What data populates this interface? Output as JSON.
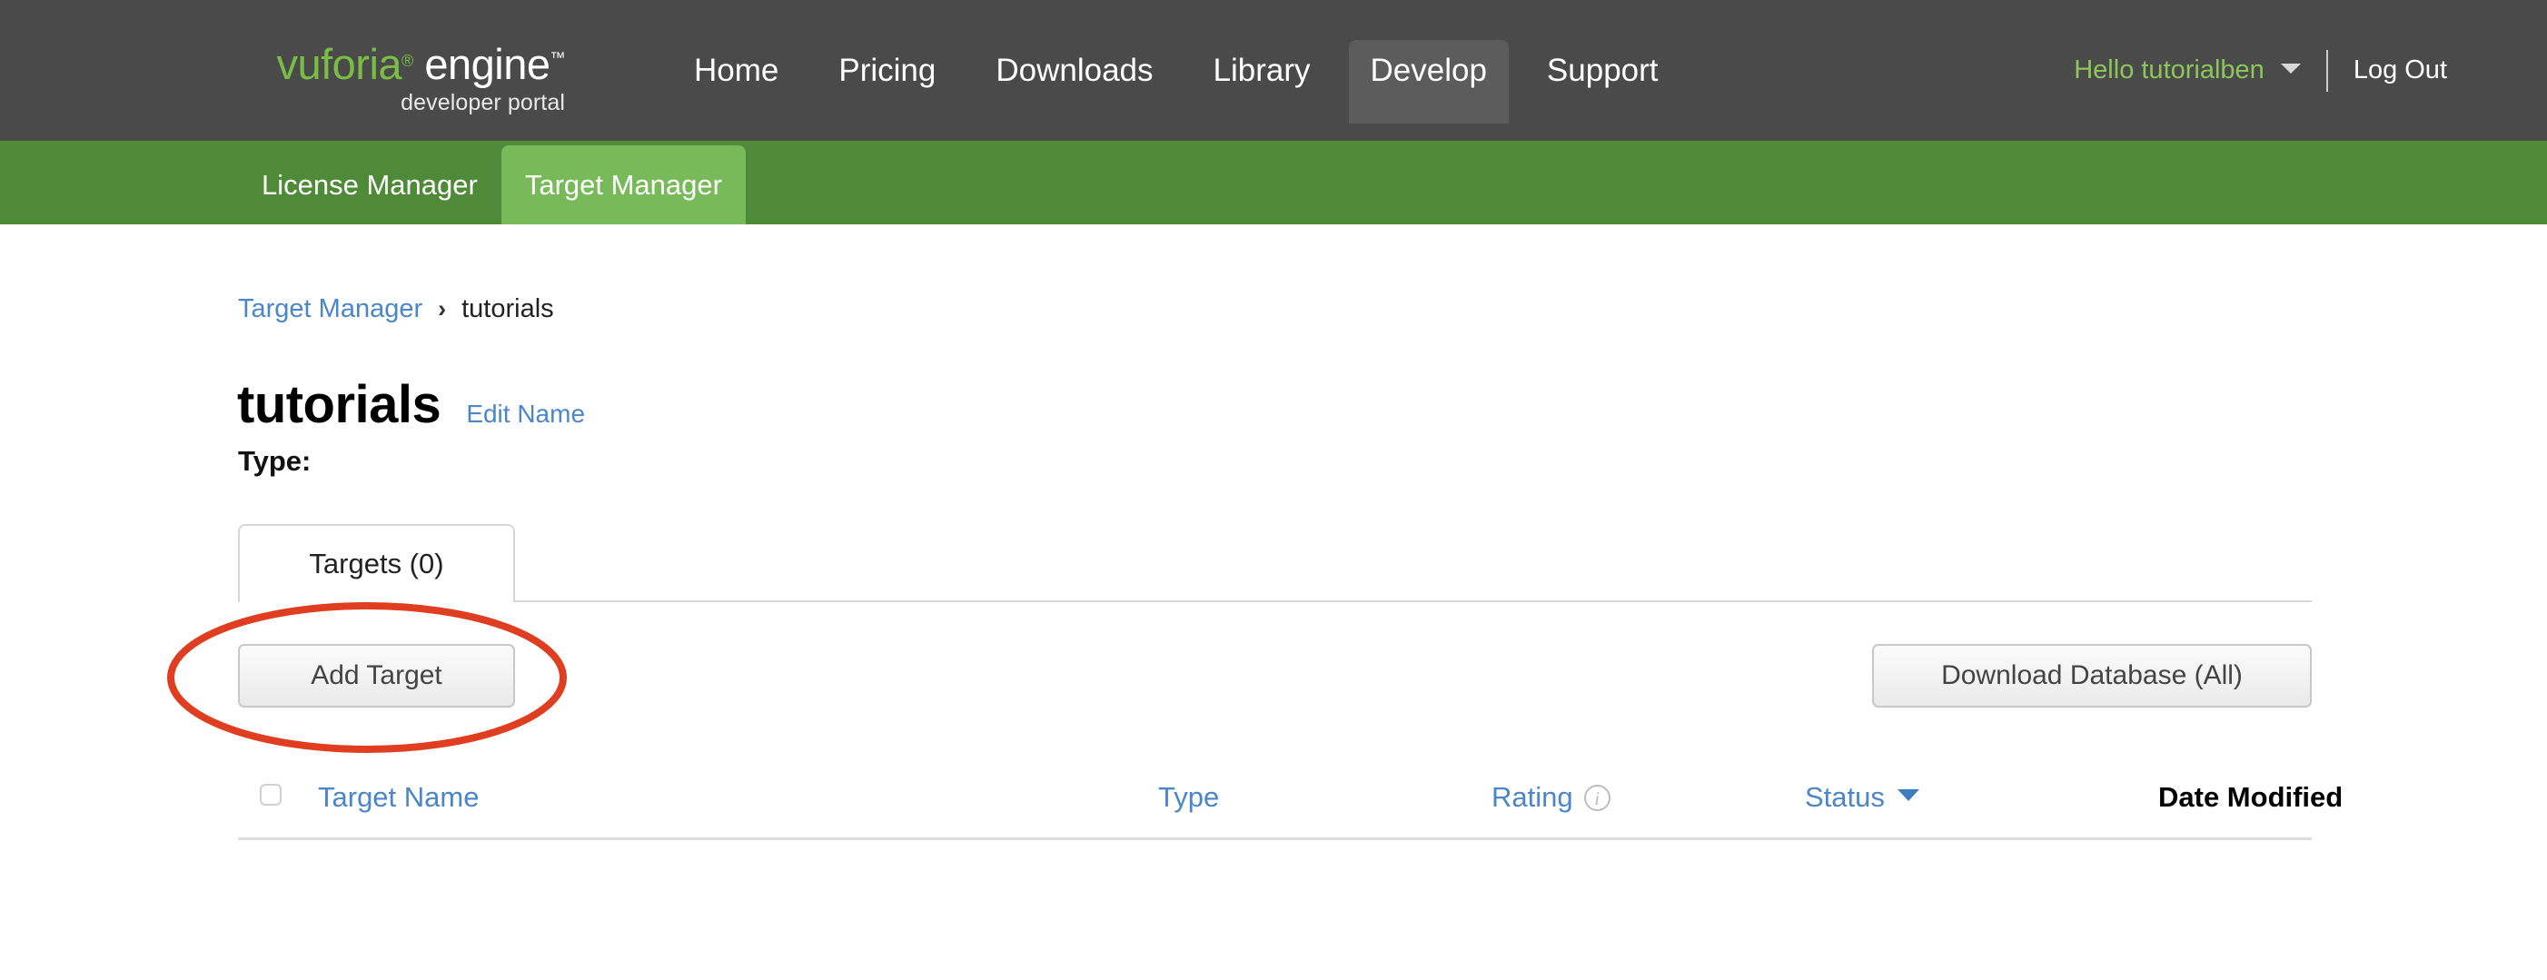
{
  "header": {
    "logo": {
      "brand": "vuforia",
      "registered": "®",
      "product": "engine",
      "trademark": "™",
      "subtitle": "developer portal"
    },
    "nav": [
      {
        "label": "Home",
        "active": false
      },
      {
        "label": "Pricing",
        "active": false
      },
      {
        "label": "Downloads",
        "active": false
      },
      {
        "label": "Library",
        "active": false
      },
      {
        "label": "Develop",
        "active": true
      },
      {
        "label": "Support",
        "active": false
      }
    ],
    "user": {
      "greeting": "Hello tutorialben",
      "logout": "Log Out"
    },
    "colors": {
      "bar": "#4a4a4a",
      "active_tab": "#5c5c5c",
      "brand_green": "#79bd45",
      "greeting_green": "#8cc65b"
    }
  },
  "subnav": {
    "items": [
      {
        "label": "License Manager",
        "active": false
      },
      {
        "label": "Target Manager",
        "active": true
      }
    ],
    "colors": {
      "bar": "#4e8a38",
      "active": "#78ba5a"
    }
  },
  "breadcrumb": {
    "parent": "Target Manager",
    "separator": "›",
    "current": "tutorials"
  },
  "page": {
    "title": "tutorials",
    "edit_link": "Edit Name",
    "type_label": "Type:",
    "type_value": ""
  },
  "tabs": [
    {
      "label": "Targets (0)",
      "active": true
    }
  ],
  "toolbar": {
    "add_target_label": "Add Target",
    "download_database_label": "Download Database (All)"
  },
  "annotation": {
    "shape": "ellipse",
    "target": "Add Target",
    "color": "#e03e20",
    "stroke_width": 7
  },
  "table": {
    "columns": [
      {
        "key": "select",
        "label": "",
        "sorted": false,
        "icon": "checkbox"
      },
      {
        "key": "name",
        "label": "Target Name",
        "sorted": false
      },
      {
        "key": "type",
        "label": "Type",
        "sorted": false
      },
      {
        "key": "rating",
        "label": "Rating",
        "sorted": false,
        "icon": "info-icon"
      },
      {
        "key": "status",
        "label": "Status",
        "sorted": false,
        "icon": "chevron-down-icon"
      },
      {
        "key": "date",
        "label": "Date Modified",
        "sorted": true
      }
    ],
    "rows": [],
    "row_count": 0,
    "colors": {
      "link": "#4a86c8",
      "sorted_header": "#000000"
    }
  }
}
